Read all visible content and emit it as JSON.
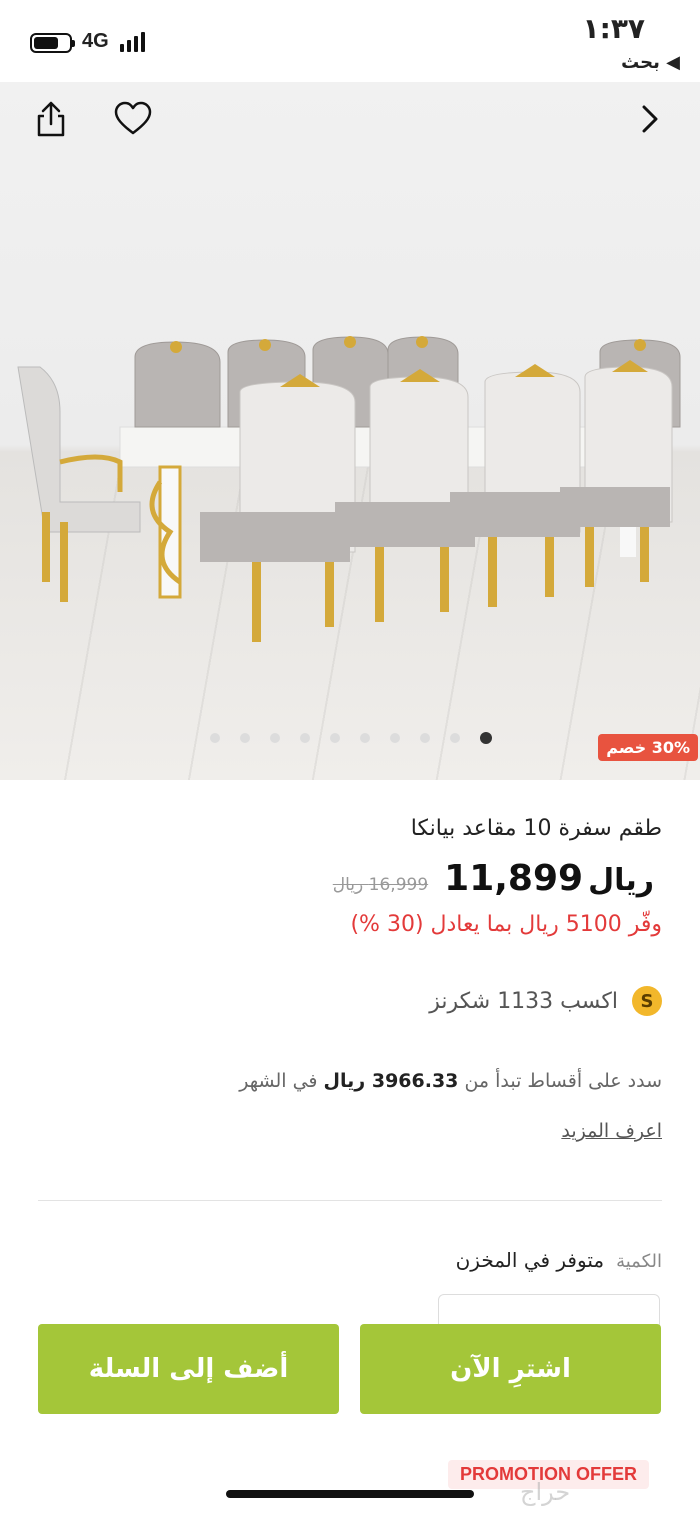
{
  "status_bar": {
    "network": "4G",
    "time": "١:٣٧",
    "back_app": "◀ بحث",
    "battery_level": 0.7
  },
  "hero": {
    "discount_badge": "30% خصم",
    "image_count": 10,
    "active_image_index": 9,
    "icons": [
      "share-icon",
      "heart-icon",
      "chevron-right-icon"
    ]
  },
  "product": {
    "title": "طقم سفرة 10 مقاعد بيانكا",
    "price": "11,899",
    "price_unit": "ريال",
    "old_price": "16,999 ريال",
    "savings": "وفّر 5100 ريال بما يعادل (30 %)",
    "points_icon": "S",
    "points": "اكسب 1133 شكرنز",
    "installment_prefix": "سدد على أقساط تبدأ من",
    "installment_amount": "3966.33 ريال",
    "installment_suffix": "في الشهر",
    "learn_more": "اعرف المزيد",
    "qty_label": "الكمية",
    "stock_status": "متوفر في المخزن"
  },
  "actions": {
    "buy_now": "اشترِ الآن",
    "add_to_cart": "أضف إلى السلة"
  },
  "promo": {
    "label": "PROMOTION OFFER"
  },
  "watermark": "حراج",
  "colors": {
    "accent": "#a4c639",
    "sale": "#e33a3a",
    "badge": "#e8533f",
    "coin": "#f2b72b"
  }
}
